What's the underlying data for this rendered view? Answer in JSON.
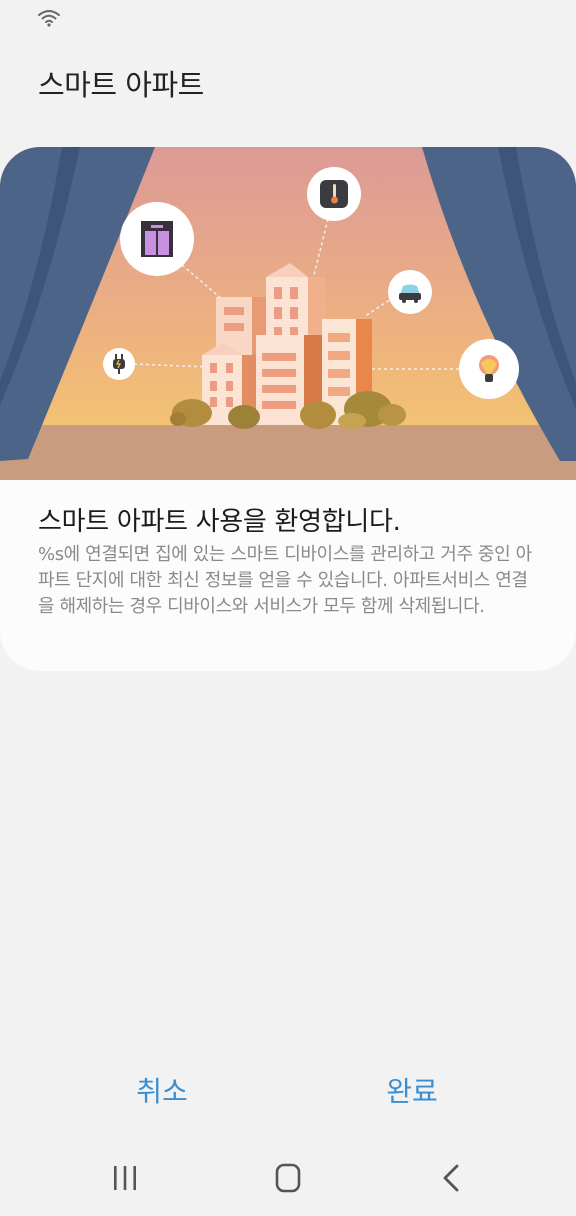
{
  "app": {
    "title": "스마트 아파트"
  },
  "status_bar": {
    "icons": [
      "wifi-icon"
    ]
  },
  "card": {
    "heading": "스마트 아파트 사용을 환영합니다.",
    "description": " %s에 연결되면 집에 있는 스마트 디바이스를 관리하고 거주 중인 아파트 단지에 대한 최신 정보를 얻을 수 있습니다. 아파트서비스 연결을 해제하는 경우 디바이스와 서비스가 모두 함께 삭제됩니다.",
    "illustration_icons": [
      "elevator-icon",
      "thermometer-icon",
      "car-icon",
      "plug-icon",
      "lightbulb-icon"
    ]
  },
  "buttons": {
    "cancel": "취소",
    "done": "완료"
  },
  "nav_bar": {
    "icons": [
      "recents-icon",
      "home-icon",
      "back-icon"
    ]
  },
  "colors": {
    "background": "#f2f2f2",
    "card": "#fcfcfc",
    "accent": "#3a8fd3",
    "curtain": "#4c6488",
    "sky_top": "#dc9a96",
    "sky_bottom": "#f6cc6c"
  }
}
